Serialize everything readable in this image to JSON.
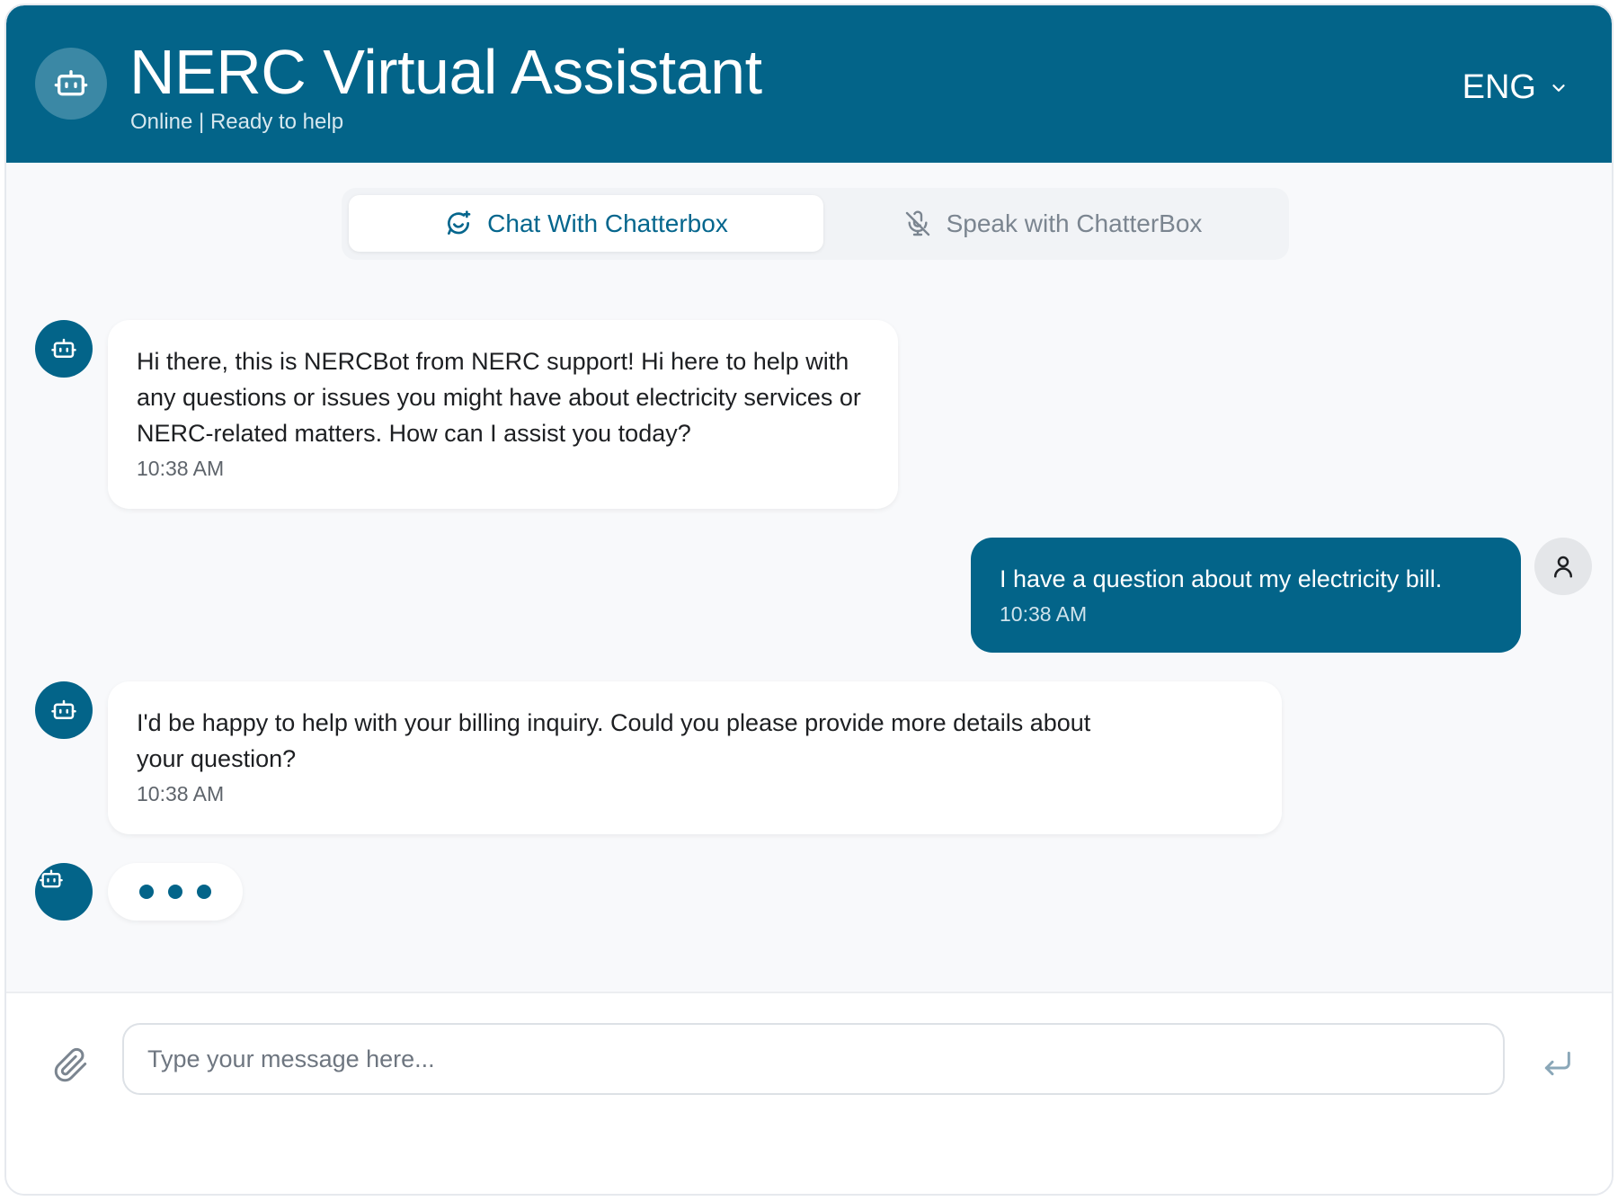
{
  "header": {
    "title": "NERC Virtual Assistant",
    "status": "Online | Ready to help",
    "language": "ENG",
    "icon": "robot-icon"
  },
  "tabs": [
    {
      "label": "Chat With Chatterbox",
      "icon": "chat-sparkle-icon",
      "active": true
    },
    {
      "label": "Speak with ChatterBox",
      "icon": "mic-off-icon",
      "active": false
    }
  ],
  "messages": [
    {
      "sender": "bot",
      "text": "Hi there, this is NERCBot from NERC support! Hi here to help with any questions or issues you might have about electricity services or NERC-related matters. How can I assist you today?",
      "time": "10:38 AM"
    },
    {
      "sender": "user",
      "text": "I have a question about my electricity bill.",
      "time": "10:38 AM"
    },
    {
      "sender": "bot",
      "text": "I'd be happy to help with your billing inquiry. Could you please provide more details about your question?",
      "time": "10:38 AM"
    }
  ],
  "composer": {
    "placeholder": "Type your message here...",
    "value": ""
  },
  "colors": {
    "primary": "#036489",
    "background": "#f8f9fb",
    "bubble": "#ffffff"
  }
}
